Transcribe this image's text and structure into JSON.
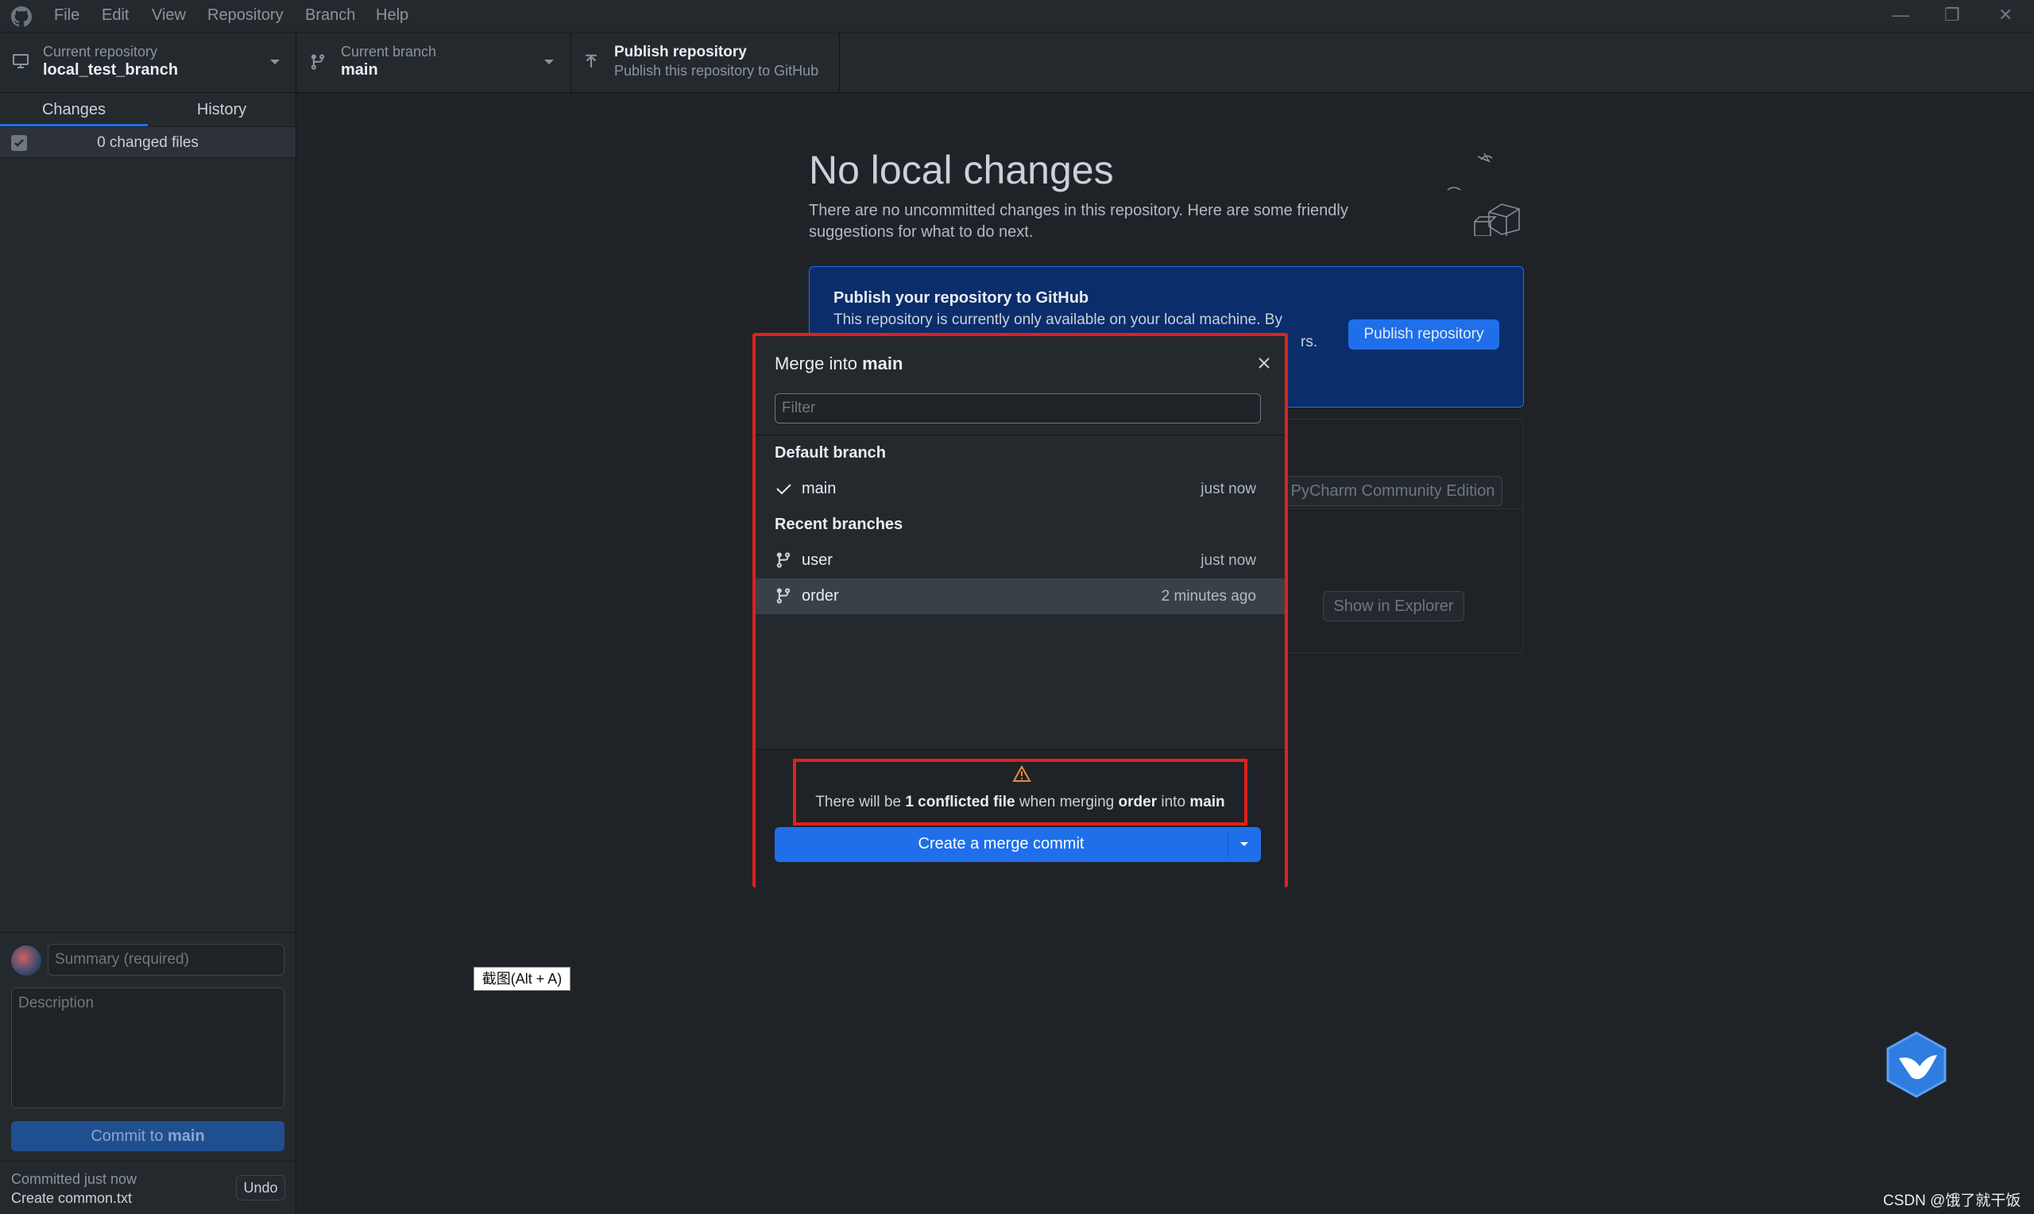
{
  "menu": [
    "File",
    "Edit",
    "View",
    "Repository",
    "Branch",
    "Help"
  ],
  "toolbar": {
    "repo_label": "Current repository",
    "repo_value": "local_test_branch",
    "branch_label": "Current branch",
    "branch_value": "main",
    "publish_title": "Publish repository",
    "publish_sub": "Publish this repository to GitHub"
  },
  "sidebar": {
    "tab_changes": "Changes",
    "tab_history": "History",
    "changed_files": "0 changed files",
    "summary_placeholder": "Summary (required)",
    "description_placeholder": "Description",
    "commit_prefix": "Commit to ",
    "commit_branch": "main",
    "last_commit_time": "Committed just now",
    "last_commit_msg": "Create common.txt",
    "undo": "Undo"
  },
  "main": {
    "title": "No local changes",
    "subtitle": "There are no uncommitted changes in this repository. Here are some friendly suggestions for what to do next.",
    "publish_card_title": "Publish your repository to GitHub",
    "publish_card_text_a": "This repository is currently only available on your local machine. By",
    "publish_card_text_b": "rs.",
    "publish_button": "Publish repository",
    "editor_button": "PyCharm Community Edition",
    "explorer_button": "Show in Explorer"
  },
  "modal": {
    "title_prefix": "Merge into ",
    "title_branch": "main",
    "filter_placeholder": "Filter",
    "default_heading": "Default branch",
    "recent_heading": "Recent branches",
    "default_branches": [
      {
        "name": "main",
        "time": "just now"
      }
    ],
    "recent_branches": [
      {
        "name": "user",
        "time": "just now"
      },
      {
        "name": "order",
        "time": "2 minutes ago"
      }
    ],
    "warn_1": "There will be ",
    "warn_2": "1 conflicted file",
    "warn_3": " when merging ",
    "warn_4": "order",
    "warn_5": " into ",
    "warn_6": "main",
    "merge_button": "Create a merge commit"
  },
  "overlay": {
    "screenshot_tip": "截图(Alt + A)",
    "watermark": "CSDN @饿了就干饭"
  },
  "colors": {
    "accent": "#1f6feb",
    "warning": "#f0883e",
    "highlight_border": "#e02020"
  }
}
